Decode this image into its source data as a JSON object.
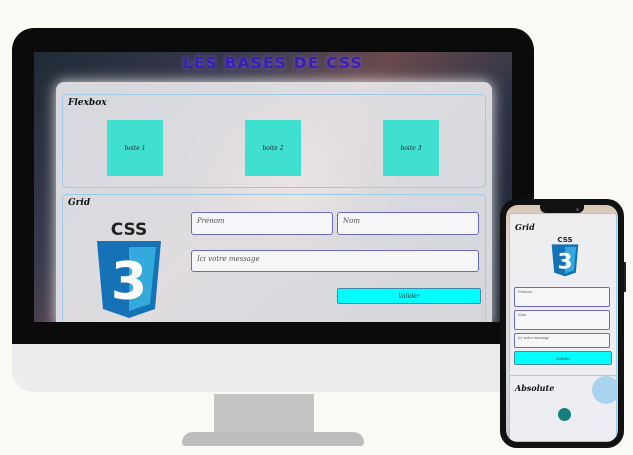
{
  "desktop": {
    "site_title": "LES BASES DE CSS",
    "flexbox": {
      "title": "Flexbox",
      "boxes": [
        "boite 1",
        "boite 2",
        "boite 3"
      ]
    },
    "grid": {
      "title": "Grid",
      "logo_text": "CSS",
      "logo_number": "3",
      "firstname_placeholder": "Prénom",
      "lastname_placeholder": "Nom",
      "message_placeholder": "Ici votre message",
      "submit_label": "Valider"
    }
  },
  "mobile": {
    "grid_title": "Grid",
    "logo_text": "CSS",
    "logo_number": "3",
    "firstname_placeholder": "Prénom",
    "lastname_placeholder": "Nom",
    "message_placeholder": "Ici votre message",
    "submit_label": "Valider",
    "absolute_title": "Absolute"
  },
  "colors": {
    "box": "#40e0d0",
    "button": "#00ffff",
    "title": "#3b1fb4",
    "css3_shield": "#1572b6"
  }
}
